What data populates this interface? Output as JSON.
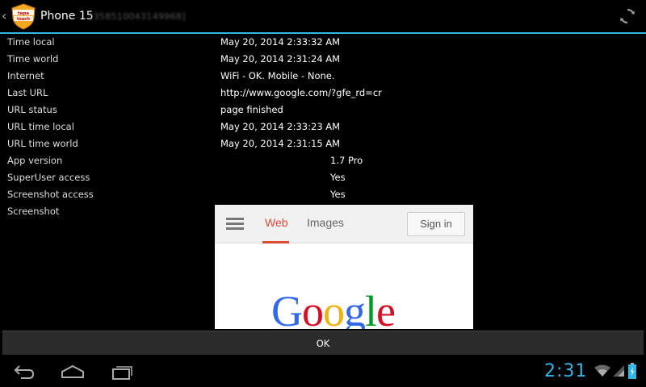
{
  "header": {
    "title": "Phone 15",
    "subtitle": "[358510043149968]",
    "app_icon_text": "tapa touch"
  },
  "rows": [
    {
      "label": "Time local",
      "value": "May 20, 2014 2:33:32 AM"
    },
    {
      "label": "Time world",
      "value": "May 20, 2014 2:31:24 AM"
    },
    {
      "label": "Internet",
      "value": "WiFi - OK. Mobile - None."
    },
    {
      "label": "Last URL",
      "value": "http://www.google.com/?gfe_rd=cr"
    },
    {
      "label": "URL status",
      "value": "page finished"
    },
    {
      "label": "URL time local",
      "value": "May 20, 2014 2:33:23 AM"
    },
    {
      "label": "URL time world",
      "value": "May 20, 2014 2:31:15 AM"
    },
    {
      "label": "App version",
      "value": "1.7 Pro"
    },
    {
      "label": "SuperUser access",
      "value": "Yes"
    },
    {
      "label": "Screenshot access",
      "value": "Yes"
    },
    {
      "label": "Screenshot",
      "value": ""
    }
  ],
  "screenshot": {
    "tab_web": "Web",
    "tab_images": "Images",
    "sign_in": "Sign in",
    "logo_letters": [
      "G",
      "o",
      "o",
      "g",
      "l",
      "e"
    ],
    "logo_colors": [
      "#3369e8",
      "#d50f25",
      "#eeb211",
      "#3369e8",
      "#009925",
      "#d50f25"
    ]
  },
  "ok_label": "OK",
  "status": {
    "clock": "2:31"
  },
  "colors": {
    "accent": "#33b5e5",
    "google_red": "#dd4b39"
  }
}
